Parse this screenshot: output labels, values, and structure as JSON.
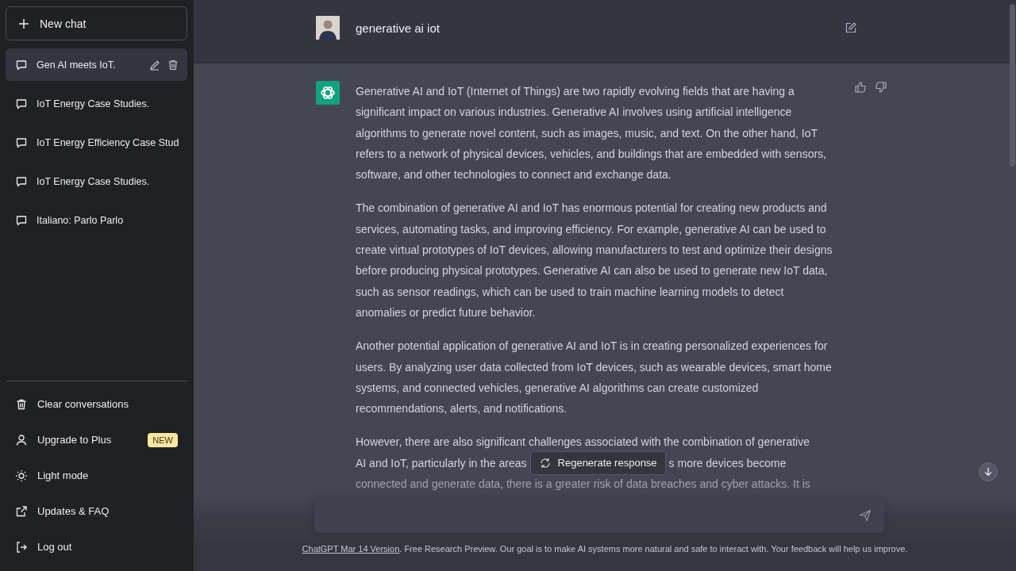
{
  "sidebar": {
    "new_chat": "New chat",
    "chats": [
      {
        "title": "Gen AI meets IoT.",
        "selected": true
      },
      {
        "title": "IoT Energy Case Studies.",
        "selected": false
      },
      {
        "title": "IoT Energy Efficiency Case Stud",
        "selected": false
      },
      {
        "title": "IoT Energy Case Studies.",
        "selected": false
      },
      {
        "title": "Italiano: Parlo Parlo",
        "selected": false
      }
    ],
    "menu": [
      {
        "kind": "trash",
        "label": "Clear conversations"
      },
      {
        "kind": "user",
        "label": "Upgrade to Plus",
        "badge": "NEW"
      },
      {
        "kind": "sun",
        "label": "Light mode"
      },
      {
        "kind": "external",
        "label": "Updates & FAQ"
      },
      {
        "kind": "logout",
        "label": "Log out"
      }
    ]
  },
  "conversation": {
    "user_message": "generative ai iot",
    "paragraphs": [
      "Generative AI and IoT (Internet of Things) are two rapidly evolving fields that are having a significant impact on various industries. Generative AI involves using artificial intelligence algorithms to generate novel content, such as images, music, and text. On the other hand, IoT refers to a network of physical devices, vehicles, and buildings that are embedded with sensors, software, and other technologies to connect and exchange data.",
      "The combination of generative AI and IoT has enormous potential for creating new products and services, automating tasks, and improving efficiency. For example, generative AI can be used to create virtual prototypes of IoT devices, allowing manufacturers to test and optimize their designs before producing physical prototypes. Generative AI can also be used to generate new IoT data, such as sensor readings, which can be used to train machine learning models to detect anomalies or predict future behavior.",
      "Another potential application of generative AI and IoT is in creating personalized experiences for users. By analyzing user data collected from IoT devices, such as wearable devices, smart home systems, and connected vehicles, generative AI algorithms can create customized recommendations, alerts, and notifications."
    ],
    "last_paragraph": {
      "line_1": "However, there are also significant challenges associated with the combination of generative",
      "line_2_start": "AI and IoT, particularly in the areas",
      "line_2_end": "s more devices become",
      "line_3": "connected and generate data, there is a greater risk of data breaches and cyber attacks. It is"
    }
  },
  "regenerate_button": "Regenerate response",
  "footer": {
    "link": "ChatGPT Mar 14 Version",
    "text": ". Free Research Preview. Our goal is to make AI systems more natural and safe to interact with. Your feedback will help us improve."
  }
}
